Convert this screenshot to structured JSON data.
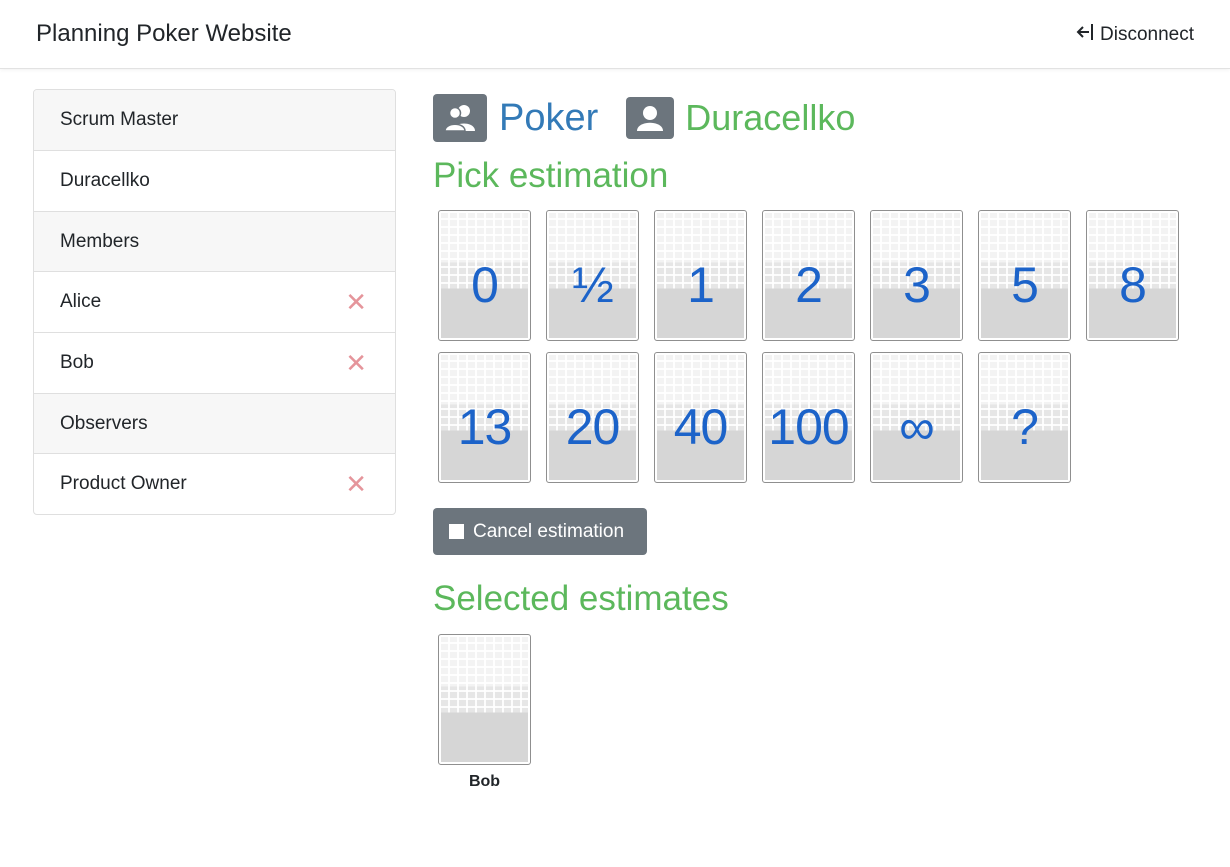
{
  "navbar": {
    "brand": "Planning Poker Website",
    "disconnect_label": "Disconnect",
    "disconnect_icon": "sign-out-icon"
  },
  "sidebar": {
    "scrum_master_header": "Scrum Master",
    "scrum_master": "Duracellko",
    "members_header": "Members",
    "members": [
      "Alice",
      "Bob"
    ],
    "observers_header": "Observers",
    "observers": [
      "Product Owner"
    ],
    "remove_symbol": "✕"
  },
  "main": {
    "team_name": "Poker",
    "team_icon": "users-icon",
    "user_name": "Duracellko",
    "user_icon": "user-icon",
    "pick_title": "Pick estimation",
    "cards": [
      "0",
      "½",
      "1",
      "2",
      "3",
      "5",
      "8",
      "13",
      "20",
      "40",
      "100",
      "∞",
      "?"
    ],
    "cancel_label": "Cancel estimation",
    "selected_title": "Selected estimates",
    "selected": [
      {
        "name": "Bob"
      }
    ]
  },
  "colors": {
    "accent_blue": "#337ab7",
    "accent_green": "#5cb85c",
    "card_text": "#1c63c9",
    "button_gray": "#6c757d",
    "remove_red": "#e5959b"
  }
}
